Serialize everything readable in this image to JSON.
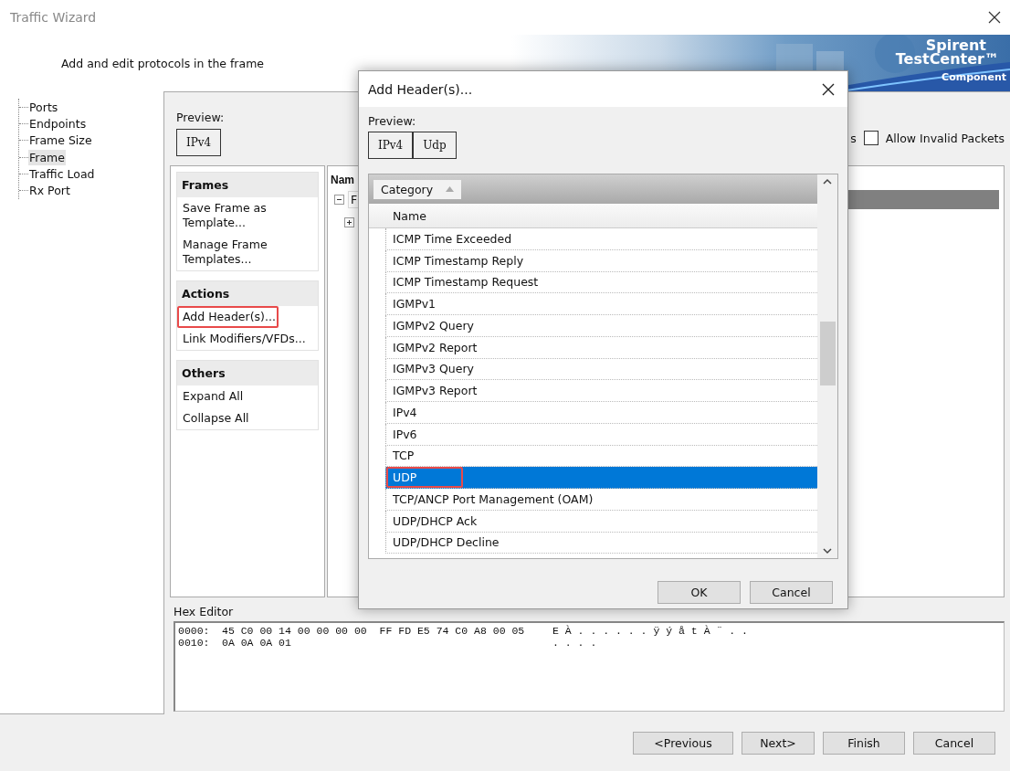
{
  "window": {
    "title": "Traffic Wizard"
  },
  "header": {
    "subtitle": "Add and edit protocols in the frame",
    "logo": {
      "line1": "Spirent",
      "line2": "TestCenter™",
      "tagline": "Component"
    }
  },
  "nav": {
    "items": [
      {
        "label": "Ports",
        "selected": false
      },
      {
        "label": "Endpoints",
        "selected": false
      },
      {
        "label": "Frame Size",
        "selected": false
      },
      {
        "label": "Frame",
        "selected": true
      },
      {
        "label": "Traffic Load",
        "selected": false
      },
      {
        "label": "Rx Port",
        "selected": false
      }
    ]
  },
  "frame_preview": {
    "label": "Preview:",
    "chips": [
      "IPv4"
    ]
  },
  "options": {
    "label_fragment": "s",
    "allow_invalid": {
      "label": "Allow Invalid Packets",
      "checked": false
    }
  },
  "action_sections": [
    {
      "title": "Frames",
      "items": [
        {
          "label": "Save Frame as Template...",
          "highlighted": false
        },
        {
          "label": "Manage Frame Templates...",
          "highlighted": false
        }
      ]
    },
    {
      "title": "Actions",
      "items": [
        {
          "label": "Add Header(s)...",
          "highlighted": true
        },
        {
          "label": "Link Modifiers/VFDs...",
          "highlighted": false
        }
      ]
    },
    {
      "title": "Others",
      "items": [
        {
          "label": "Expand All",
          "highlighted": false
        },
        {
          "label": "Collapse All",
          "highlighted": false
        }
      ]
    }
  ],
  "frame_tree": {
    "column": "Nam",
    "nodes": [
      {
        "label": "F",
        "expanded": true,
        "selected": true,
        "children": [
          {
            "expanded": false
          }
        ]
      }
    ]
  },
  "hex_editor": {
    "label": "Hex Editor",
    "lines": [
      {
        "offset": "0000:",
        "hex": "45 C0 00 14 00 00 00 00  FF FD E5 74 C0 A8 00 05",
        "ascii": "E À . . . . . . ÿ ý å t À ¨ . ."
      },
      {
        "offset": "0010:",
        "hex": "0A 0A 0A 01",
        "ascii": ". . . ."
      }
    ]
  },
  "footer_buttons": [
    "<Previous",
    "Next>",
    "Finish",
    "Cancel"
  ],
  "dialog": {
    "title": "Add Header(s)...",
    "preview_label": "Preview:",
    "chips": [
      "IPv4",
      "Udp"
    ],
    "group_by": "Category",
    "column": "Name",
    "rows": [
      {
        "name": "ICMP Time Exceeded",
        "selected": false,
        "highlighted": false
      },
      {
        "name": "ICMP Timestamp Reply",
        "selected": false,
        "highlighted": false
      },
      {
        "name": "ICMP Timestamp Request",
        "selected": false,
        "highlighted": false
      },
      {
        "name": "IGMPv1",
        "selected": false,
        "highlighted": false
      },
      {
        "name": "IGMPv2 Query",
        "selected": false,
        "highlighted": false
      },
      {
        "name": "IGMPv2 Report",
        "selected": false,
        "highlighted": false
      },
      {
        "name": "IGMPv3 Query",
        "selected": false,
        "highlighted": false
      },
      {
        "name": "IGMPv3 Report",
        "selected": false,
        "highlighted": false
      },
      {
        "name": "IPv4",
        "selected": false,
        "highlighted": false
      },
      {
        "name": "IPv6",
        "selected": false,
        "highlighted": false
      },
      {
        "name": "TCP",
        "selected": false,
        "highlighted": false
      },
      {
        "name": "UDP",
        "selected": true,
        "highlighted": true
      },
      {
        "name": "TCP/ANCP Port Management (OAM)",
        "selected": false,
        "highlighted": false
      },
      {
        "name": "UDP/DHCP Ack",
        "selected": false,
        "highlighted": false
      },
      {
        "name": "UDP/DHCP Decline",
        "selected": false,
        "highlighted": false
      }
    ],
    "buttons": [
      "OK",
      "Cancel"
    ]
  }
}
